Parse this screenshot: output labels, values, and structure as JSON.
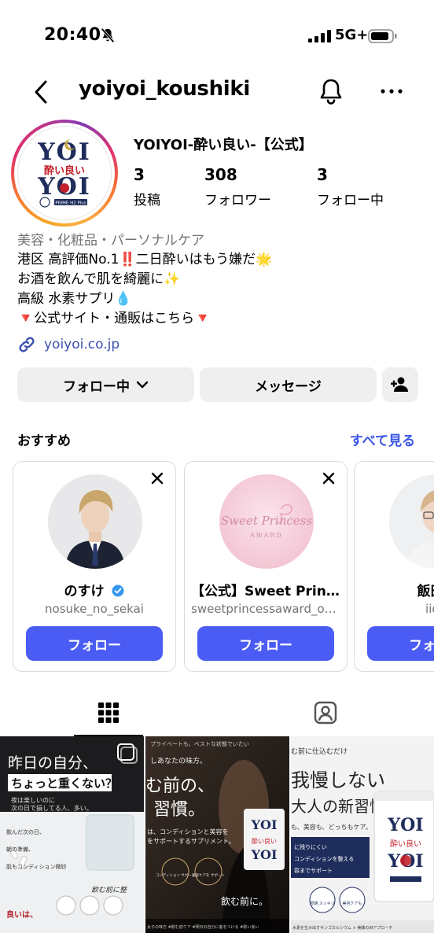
{
  "status_bar": {
    "time": "20:40",
    "network": "5G+"
  },
  "header": {
    "username": "yoiyoi_koushiki"
  },
  "profile": {
    "display_name": "YOIYOI-酔い良い-【公式】",
    "avatar_text": {
      "top": "YOI",
      "middle": "酔い良い",
      "bottom": "YOI",
      "tag": "PRIME H2 Plus"
    },
    "stats": [
      {
        "value": "3",
        "label": "投稿"
      },
      {
        "value": "308",
        "label": "フォロワー"
      },
      {
        "value": "3",
        "label": "フォロー中"
      }
    ],
    "bio": {
      "category": "美容・化粧品・パーソナルケア",
      "lines": [
        "港区 高評価No.1‼️二日酔いはもう嫌だ🌟",
        "お酒を飲んで肌を綺麗に✨",
        "高級 水素サプリ💧",
        "🔻公式サイト・通販はこちら🔻"
      ],
      "link": "yoiyoi.co.jp"
    }
  },
  "actions": {
    "following_label": "フォロー中",
    "message_label": "メッセージ"
  },
  "recommended": {
    "title": "おすすめ",
    "see_all": "すべて見る",
    "cards": [
      {
        "name": "のすけ",
        "handle": "nosuke_no_sekai",
        "follow": "フォロー",
        "verified": true
      },
      {
        "name": "【公式】Sweet Princess AWARD",
        "handle": "sweetprincessaward_official",
        "follow": "フォロー",
        "avatar_text": "Sweet Princess",
        "avatar_sub": "AWARD"
      },
      {
        "name": "飯田 礼",
        "handle": "iiday",
        "follow": "フォロー"
      }
    ]
  },
  "posts": [
    {
      "headline": "昨日の自分、",
      "headline2": "ちょっと重くない？",
      "sub": "夜は楽しいのに",
      "sub2": "次の日で損してる人、多い。",
      "list": [
        "飲んだ次の日、",
        "朝の準備、",
        "肌もコンディション微妙"
      ],
      "footer": "良いは、",
      "quote": "飲む前に整"
    },
    {
      "top": "プライベートも、ベストな状態でいたい",
      "mid": "しあなたの味方。",
      "headline": "む前の、",
      "headline2": "習慣。",
      "sub": "は、コンディションと美容を",
      "sub2": "をサポートするサプリメント。",
      "chip1": "コンディション サポート",
      "chip2": "美容ケアを サポート",
      "end": "飲む前に。",
      "bottom": "女子の味方 #飲む前ケア #明日の自分に差をつける #酔い良い"
    },
    {
      "top": "む前に仕込むだけ",
      "headline": "我慢しない",
      "headline2": "大人の新習慣。",
      "sub": "も、美容も、どっちもケア。",
      "box1": "に残りにくい",
      "box2": "コンディションを整える",
      "box3": "容までサポート",
      "chip1": "翌朝 スッキリ",
      "chip2": "美容ケアも",
      "pkg_top": "YOI",
      "pkg_mid": "酔い良い",
      "pkg_bot": "YOI",
      "bottom": "水素を生み出すサンゴカルシウム × 美酵のWアプローチ"
    }
  ]
}
